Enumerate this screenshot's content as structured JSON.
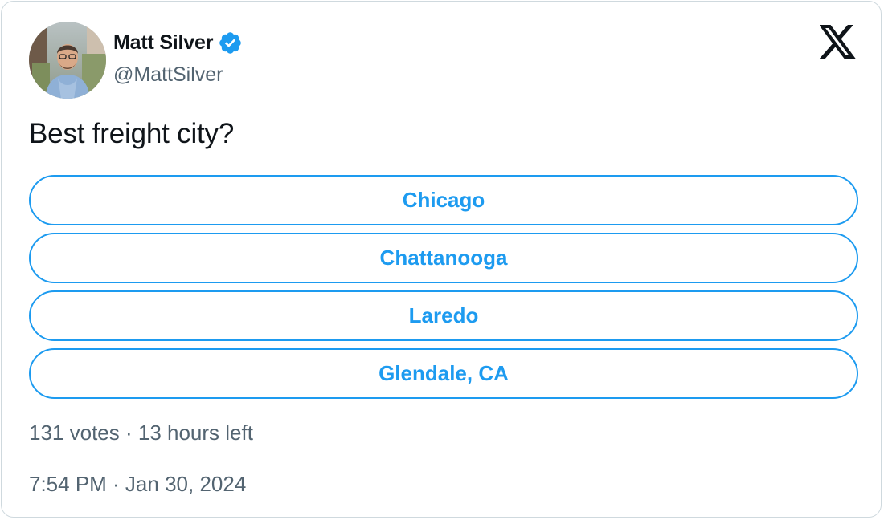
{
  "author": {
    "name": "Matt Silver",
    "handle": "@MattSilver",
    "verified": true,
    "avatar_icon": "profile-photo",
    "verified_icon": "verified-badge-icon"
  },
  "brand": {
    "logo_icon": "x-logo-icon",
    "accent_color": "#1d9bf0"
  },
  "tweet": {
    "text": "Best freight city?"
  },
  "poll": {
    "options": [
      {
        "label": "Chicago"
      },
      {
        "label": "Chattanooga"
      },
      {
        "label": "Laredo"
      },
      {
        "label": "Glendale, CA"
      }
    ],
    "meta": "131 votes · 13 hours left"
  },
  "timestamp": "7:54 PM · Jan 30, 2024"
}
